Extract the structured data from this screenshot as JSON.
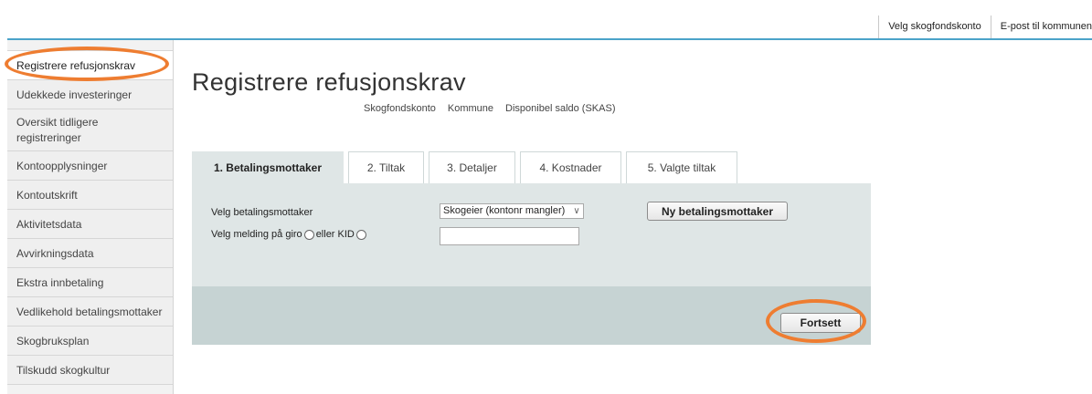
{
  "topnav": {
    "items": [
      "Velg skogfondskonto",
      "E-post til kommunen"
    ]
  },
  "sidebar": {
    "items": [
      "Registrere refusjonskrav",
      "Udekkede investeringer",
      "Oversikt tidligere registreringer",
      "Kontoopplysninger",
      "Kontoutskrift",
      "Aktivitetsdata",
      "Avvirkningsdata",
      "Ekstra innbetaling",
      "Vedlikehold betalingsmottaker",
      "Skogbruksplan",
      "Tilskudd skogkultur"
    ]
  },
  "page": {
    "title": "Registrere refusjonskrav",
    "meta": [
      "Skogfondskonto",
      "Kommune",
      "Disponibel saldo (SKAS)"
    ]
  },
  "tabs": [
    "1. Betalingsmottaker",
    "2. Tiltak",
    "3. Detaljer",
    "4. Kostnader",
    "5. Valgte tiltak"
  ],
  "form": {
    "recipient_label": "Velg betalingsmottaker",
    "recipient_selected": "Skogeier  (kontonr mangler)",
    "message_label": "Velg melding på giro",
    "or_kid_label": "eller KID",
    "message_value": "",
    "new_recipient_button": "Ny betalingsmottaker",
    "continue_button": "Fortsett"
  },
  "colors": {
    "accent_line": "#4aa3c9",
    "highlight": "#ee7d31",
    "panel": "#dfe6e6",
    "footer_panel": "#c6d3d3"
  }
}
